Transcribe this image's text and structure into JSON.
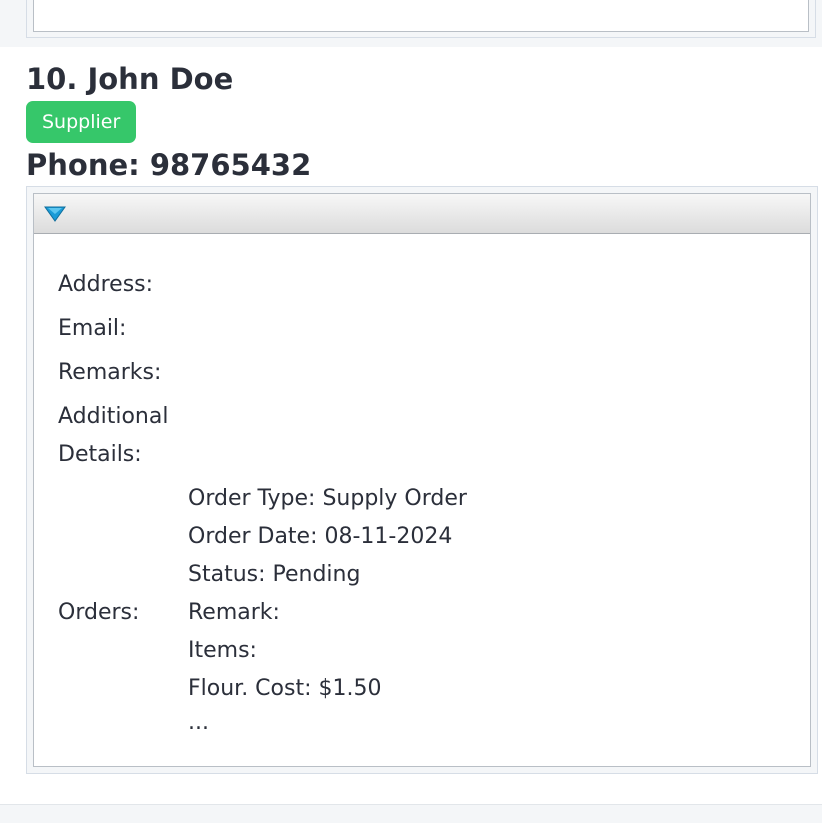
{
  "contact": {
    "title": "10. John Doe",
    "badge": "Supplier",
    "phone": "Phone: 98765432"
  },
  "details": {
    "toggle_icon": "triangle-down-icon",
    "address_label": "Address:",
    "email_label": "Email:",
    "remarks_label": "Remarks:",
    "additional_label_line1": "Additional",
    "additional_label_line2": "Details:",
    "orders_label": "Orders:",
    "orders": {
      "type": "Order Type: Supply Order",
      "date": "Order Date: 08-11-2024",
      "status": "Status: Pending",
      "remark": "Remark:",
      "items_label": "Items:",
      "item": "Flour. Cost: $1.50",
      "more": "..."
    }
  },
  "colors": {
    "badge_bg": "#36c76a",
    "toggle_icon": "#1a9bd7"
  }
}
